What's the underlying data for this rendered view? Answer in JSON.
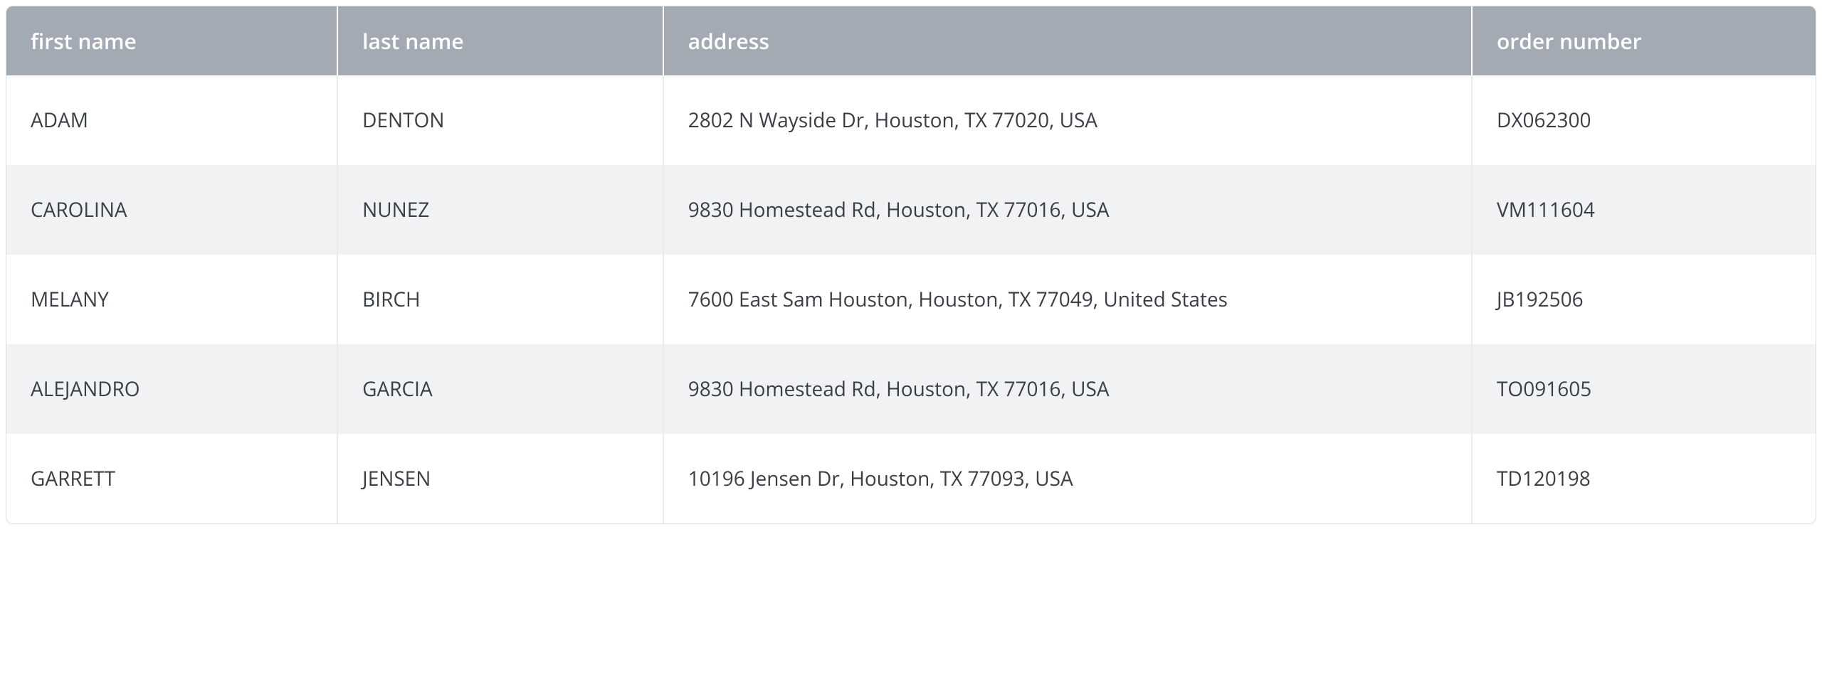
{
  "columns": [
    {
      "label": "first name"
    },
    {
      "label": "last name"
    },
    {
      "label": "address"
    },
    {
      "label": "order number"
    }
  ],
  "rows": [
    {
      "first_name": "ADAM",
      "last_name": "DENTON",
      "address": "2802 N Wayside Dr, Houston, TX 77020, USA",
      "order_number": "DX062300"
    },
    {
      "first_name": "CAROLINA",
      "last_name": "NUNEZ",
      "address": "9830 Homestead Rd, Houston, TX 77016, USA",
      "order_number": "VM111604"
    },
    {
      "first_name": "MELANY",
      "last_name": "BIRCH",
      "address": "7600 East Sam Houston, Houston, TX 77049, United States",
      "order_number": "JB192506"
    },
    {
      "first_name": "ALEJANDRO",
      "last_name": "GARCIA",
      "address": "9830 Homestead Rd, Houston, TX 77016, USA",
      "order_number": "TO091605"
    },
    {
      "first_name": "GARRETT",
      "last_name": "JENSEN",
      "address": "10196 Jensen Dr, Houston, TX 77093, USA",
      "order_number": "TD120198"
    }
  ]
}
